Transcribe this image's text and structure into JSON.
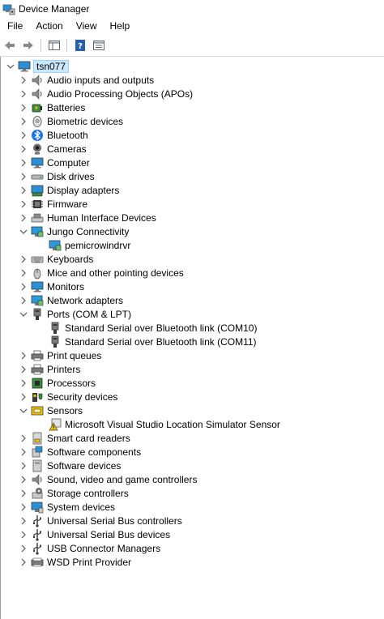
{
  "window": {
    "title": "Device Manager"
  },
  "menu": [
    "File",
    "Action",
    "View",
    "Help"
  ],
  "tree": {
    "root": "tsn077",
    "categories": [
      {
        "label": "Audio inputs and outputs",
        "icon": "speaker-icon",
        "expanded": false
      },
      {
        "label": "Audio Processing Objects (APOs)",
        "icon": "speaker-icon",
        "expanded": false
      },
      {
        "label": "Batteries",
        "icon": "battery-icon",
        "expanded": false
      },
      {
        "label": "Biometric devices",
        "icon": "fingerprint-icon",
        "expanded": false
      },
      {
        "label": "Bluetooth",
        "icon": "bluetooth-icon",
        "expanded": false
      },
      {
        "label": "Cameras",
        "icon": "camera-icon",
        "expanded": false
      },
      {
        "label": "Computer",
        "icon": "computer-icon",
        "expanded": false
      },
      {
        "label": "Disk drives",
        "icon": "disk-drive-icon",
        "expanded": false
      },
      {
        "label": "Display adapters",
        "icon": "display-adapter-icon",
        "expanded": false
      },
      {
        "label": "Firmware",
        "icon": "firmware-icon",
        "expanded": false
      },
      {
        "label": "Human Interface Devices",
        "icon": "hid-icon",
        "expanded": false
      },
      {
        "label": "Jungo Connectivity",
        "icon": "network-monitor-icon",
        "expanded": true,
        "children": [
          {
            "label": "pemicrowindrvr",
            "icon": "network-monitor-icon"
          }
        ]
      },
      {
        "label": "Keyboards",
        "icon": "keyboard-icon",
        "expanded": false
      },
      {
        "label": "Mice and other pointing devices",
        "icon": "mouse-icon",
        "expanded": false
      },
      {
        "label": "Monitors",
        "icon": "monitor-icon",
        "expanded": false
      },
      {
        "label": "Network adapters",
        "icon": "network-adapter-icon",
        "expanded": false
      },
      {
        "label": "Ports (COM & LPT)",
        "icon": "port-icon",
        "expanded": true,
        "children": [
          {
            "label": "Standard Serial over Bluetooth link (COM10)",
            "icon": "port-icon"
          },
          {
            "label": "Standard Serial over Bluetooth link (COM11)",
            "icon": "port-icon"
          }
        ]
      },
      {
        "label": "Print queues",
        "icon": "printer-icon",
        "expanded": false
      },
      {
        "label": "Printers",
        "icon": "printer-icon",
        "expanded": false
      },
      {
        "label": "Processors",
        "icon": "processor-icon",
        "expanded": false
      },
      {
        "label": "Security devices",
        "icon": "security-device-icon",
        "expanded": false
      },
      {
        "label": "Sensors",
        "icon": "sensor-icon",
        "expanded": true,
        "children": [
          {
            "label": "Microsoft Visual Studio Location Simulator Sensor",
            "icon": "warning-sensor-icon"
          }
        ]
      },
      {
        "label": "Smart card readers",
        "icon": "smart-card-icon",
        "expanded": false
      },
      {
        "label": "Software components",
        "icon": "software-component-icon",
        "expanded": false
      },
      {
        "label": "Software devices",
        "icon": "software-device-icon",
        "expanded": false
      },
      {
        "label": "Sound, video and game controllers",
        "icon": "speaker-icon",
        "expanded": false
      },
      {
        "label": "Storage controllers",
        "icon": "storage-controller-icon",
        "expanded": false
      },
      {
        "label": "System devices",
        "icon": "system-device-icon",
        "expanded": false
      },
      {
        "label": "Universal Serial Bus controllers",
        "icon": "usb-icon",
        "expanded": false
      },
      {
        "label": "Universal Serial Bus devices",
        "icon": "usb-icon",
        "expanded": false
      },
      {
        "label": "USB Connector Managers",
        "icon": "usb-icon",
        "expanded": false
      },
      {
        "label": "WSD Print Provider",
        "icon": "wsd-printer-icon",
        "expanded": false
      }
    ]
  },
  "colors": {
    "selection_bg": "#cce8ff",
    "selection_border": "#99d1ff",
    "monitor_blue": "#2b8fd6",
    "bluetooth_blue": "#1a73e8",
    "warning_yellow": "#f2c200"
  }
}
